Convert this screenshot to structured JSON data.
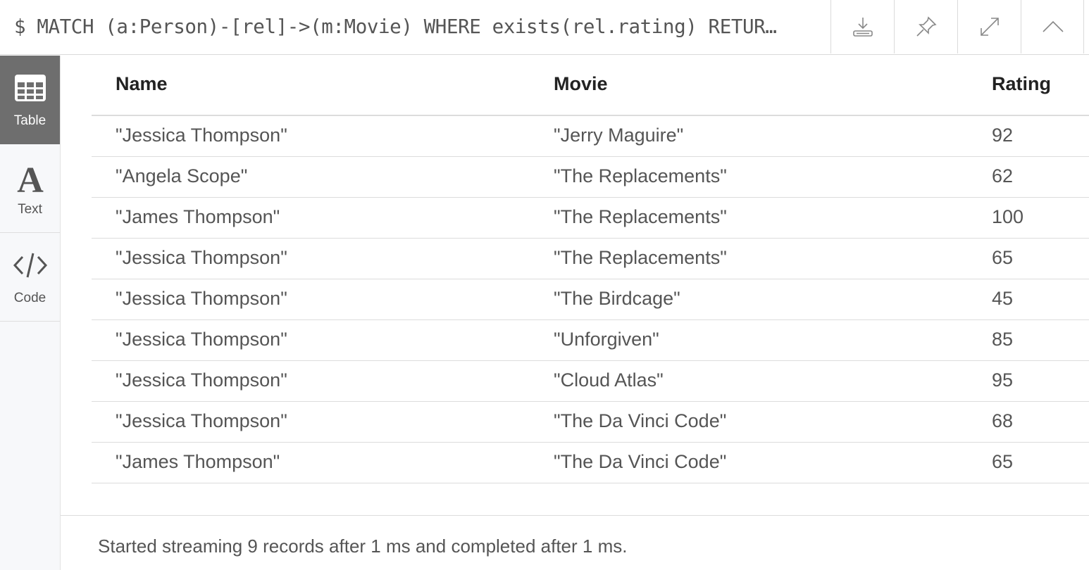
{
  "query": {
    "text": "$ MATCH (a:Person)-[rel]->(m:Movie) WHERE exists(rel.rating) RETUR…"
  },
  "toolbar": {
    "icons": [
      "download-icon",
      "pin-icon",
      "expand-icon",
      "collapse-icon"
    ]
  },
  "sidebar": {
    "items": [
      {
        "label": "Table",
        "icon": "table-icon",
        "active": true
      },
      {
        "label": "Text",
        "icon": "text-icon",
        "active": false
      },
      {
        "label": "Code",
        "icon": "code-icon",
        "active": false
      }
    ]
  },
  "table": {
    "columns": [
      "Name",
      "Movie",
      "Rating"
    ],
    "rows": [
      [
        "\"Jessica Thompson\"",
        "\"Jerry Maguire\"",
        "92"
      ],
      [
        "\"Angela Scope\"",
        "\"The Replacements\"",
        "62"
      ],
      [
        "\"James Thompson\"",
        "\"The Replacements\"",
        "100"
      ],
      [
        "\"Jessica Thompson\"",
        "\"The Replacements\"",
        "65"
      ],
      [
        "\"Jessica Thompson\"",
        "\"The Birdcage\"",
        "45"
      ],
      [
        "\"Jessica Thompson\"",
        "\"Unforgiven\"",
        "85"
      ],
      [
        "\"Jessica Thompson\"",
        "\"Cloud Atlas\"",
        "95"
      ],
      [
        "\"Jessica Thompson\"",
        "\"The Da Vinci Code\"",
        "68"
      ],
      [
        "\"James Thompson\"",
        "\"The Da Vinci Code\"",
        "65"
      ]
    ]
  },
  "status": {
    "text": "Started streaming 9 records after 1 ms and completed after 1 ms."
  },
  "colors": {
    "sidebar_active": "#6e6e6e",
    "border": "#dcdcdc"
  }
}
